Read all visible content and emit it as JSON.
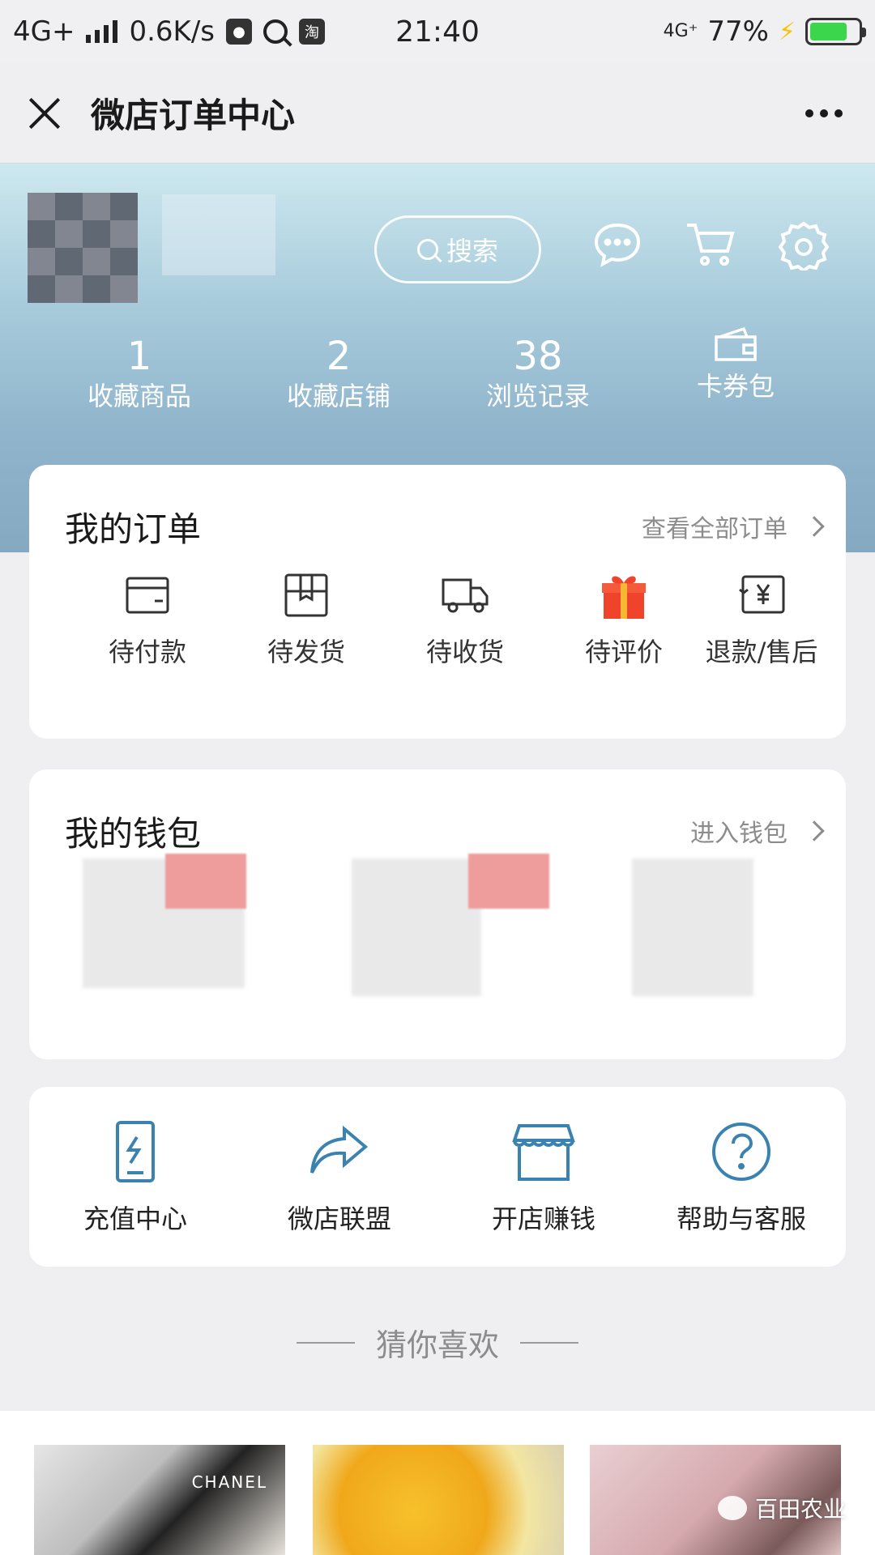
{
  "status_bar": {
    "network": "4G+",
    "speed": "0.6K/s",
    "app_badge": "淘",
    "time": "21:40",
    "network_right": "4G⁺",
    "battery_percent": "77%",
    "battery_level": 0.77,
    "colors": {
      "battery_fill": "#3bd64b",
      "charging_bolt": "#f5c400"
    }
  },
  "title_bar": {
    "title": "微店订单中心"
  },
  "header": {
    "search_label": "搜索",
    "stats": [
      {
        "value": "1",
        "label": "收藏商品"
      },
      {
        "value": "2",
        "label": "收藏店铺"
      },
      {
        "value": "38",
        "label": "浏览记录"
      },
      {
        "value": "",
        "label": "卡券包",
        "icon": "wallet-icon"
      }
    ]
  },
  "orders": {
    "title": "我的订单",
    "view_all": "查看全部订单",
    "items": [
      {
        "label": "待付款",
        "icon": "card-icon"
      },
      {
        "label": "待发货",
        "icon": "box-icon"
      },
      {
        "label": "待收货",
        "icon": "truck-icon"
      },
      {
        "label": "待评价",
        "icon": "gift-icon"
      },
      {
        "label": "退款/售后",
        "icon": "refund-icon"
      }
    ]
  },
  "wallet": {
    "title": "我的钱包",
    "enter": "进入钱包"
  },
  "services": {
    "items": [
      {
        "label": "充值中心",
        "icon": "recharge-icon"
      },
      {
        "label": "微店联盟",
        "icon": "share-icon"
      },
      {
        "label": "开店赚钱",
        "icon": "store-icon"
      },
      {
        "label": "帮助与客服",
        "icon": "help-icon"
      }
    ],
    "colors": {
      "icon": "#3a83b0"
    }
  },
  "recommend": {
    "heading": "猜你喜欢",
    "thumb_brand": "CHANEL"
  },
  "watermark": {
    "text": "百田农业"
  }
}
